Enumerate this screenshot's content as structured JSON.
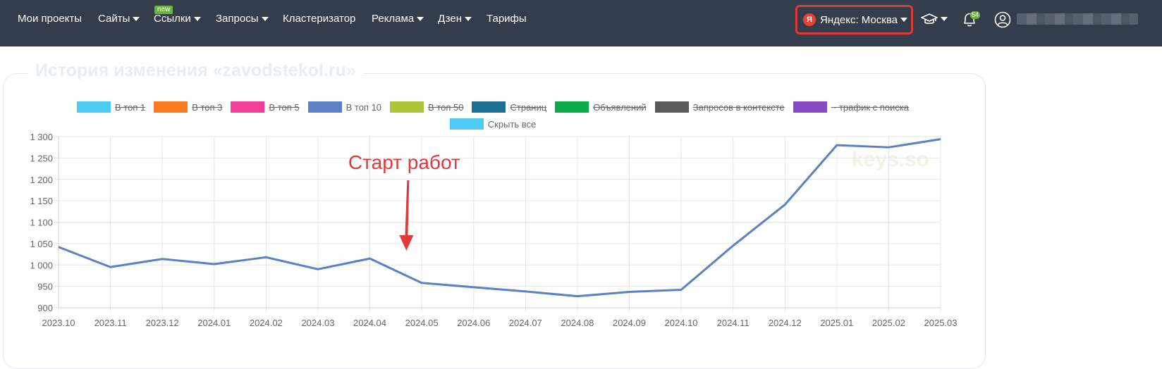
{
  "nav": {
    "items": [
      {
        "label": "Мои проекты",
        "dropdown": false
      },
      {
        "label": "Сайты",
        "dropdown": true
      },
      {
        "label": "Ссылки",
        "dropdown": true
      },
      {
        "label": "Запросы",
        "dropdown": true
      },
      {
        "label": "Кластеризатор",
        "dropdown": false
      },
      {
        "label": "Реклама",
        "dropdown": true
      },
      {
        "label": "Дзен",
        "dropdown": true
      },
      {
        "label": "Тарифы",
        "dropdown": false
      }
    ],
    "new_badge": "new",
    "region_icon": "Я",
    "region_label": "Яндекс: Москва",
    "notifications_count": "54"
  },
  "panel": {
    "title": "История изменения «zavodstekol.ru»"
  },
  "legend": {
    "row1": [
      {
        "label": "В топ 1",
        "color": "#4fcaf5",
        "active": false
      },
      {
        "label": "В топ 3",
        "color": "#f97a1f",
        "active": false
      },
      {
        "label": "В топ 5",
        "color": "#f23e99",
        "active": false
      },
      {
        "label": "В топ 10",
        "color": "#5b80c8",
        "active": true
      },
      {
        "label": "В топ 50",
        "color": "#adc43a",
        "active": false
      },
      {
        "label": "Страниц",
        "color": "#1b6f90",
        "active": false
      },
      {
        "label": "Объявлений",
        "color": "#0bab4c",
        "active": false
      },
      {
        "label": "Запросов в контексте",
        "color": "#5a5a5a",
        "active": false
      },
      {
        "label": "~ трафик с поиска",
        "color": "#8649c3",
        "active": false
      }
    ],
    "row2": [
      {
        "label": "Скрыть все",
        "color": "#4fcaf5",
        "active": true
      }
    ]
  },
  "chart_data": {
    "type": "line",
    "x": [
      "2023.10",
      "2023.11",
      "2023.12",
      "2024.01",
      "2024.02",
      "2024.03",
      "2024.04",
      "2024.05",
      "2024.06",
      "2024.07",
      "2024.08",
      "2024.09",
      "2024.10",
      "2024.11",
      "2024.12",
      "2025.01",
      "2025.02",
      "2025.03"
    ],
    "y_ticks": [
      "1 300",
      "1 250",
      "1 200",
      "1 150",
      "1 100",
      "1 050",
      "1 000",
      "950",
      "900"
    ],
    "ylim": [
      900,
      1300
    ],
    "series": [
      {
        "name": "В топ 10",
        "color": "#5b80c8",
        "values": [
          1042,
          995,
          1014,
          1002,
          1018,
          990,
          1015,
          958,
          948,
          938,
          927,
          937,
          942,
          1045,
          1141,
          1280,
          1275,
          1294
        ]
      }
    ],
    "annotation": {
      "text": "Старт работ",
      "x": "2024.04",
      "color": "#e0393b"
    },
    "watermark": "keys.so",
    "grid": true
  }
}
